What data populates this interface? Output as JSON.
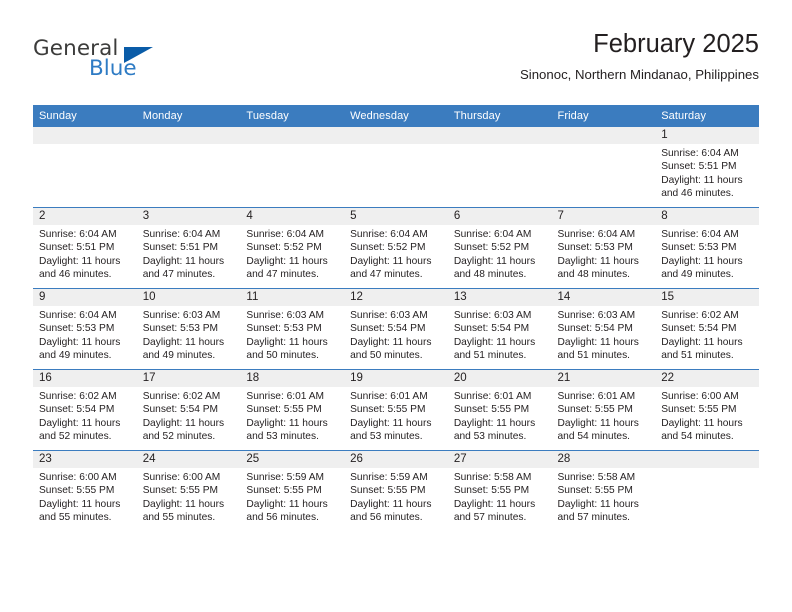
{
  "brand": {
    "name_part1": "General",
    "name_part2": "Blue",
    "flag_icon": "triangle-flag-icon"
  },
  "header": {
    "title": "February 2025",
    "subtitle": "Sinonoc, Northern Mindanao, Philippines"
  },
  "colors": {
    "header_blue": "#3b7cbf",
    "brand_blue": "#2e7bc4",
    "flag_blue": "#0a5ca8",
    "daynum_band": "#efefef",
    "text": "#231f20"
  },
  "weekdays": [
    "Sunday",
    "Monday",
    "Tuesday",
    "Wednesday",
    "Thursday",
    "Friday",
    "Saturday"
  ],
  "labels": {
    "sunrise": "Sunrise:",
    "sunset": "Sunset:",
    "daylight": "Daylight:"
  },
  "weeks": [
    [
      {
        "day": "",
        "empty": true
      },
      {
        "day": "",
        "empty": true
      },
      {
        "day": "",
        "empty": true
      },
      {
        "day": "",
        "empty": true
      },
      {
        "day": "",
        "empty": true
      },
      {
        "day": "",
        "empty": true
      },
      {
        "day": "1",
        "sunrise": "Sunrise: 6:04 AM",
        "sunset": "Sunset: 5:51 PM",
        "daylight_1": "Daylight: 11 hours",
        "daylight_2": "and 46 minutes."
      }
    ],
    [
      {
        "day": "2",
        "sunrise": "Sunrise: 6:04 AM",
        "sunset": "Sunset: 5:51 PM",
        "daylight_1": "Daylight: 11 hours",
        "daylight_2": "and 46 minutes."
      },
      {
        "day": "3",
        "sunrise": "Sunrise: 6:04 AM",
        "sunset": "Sunset: 5:51 PM",
        "daylight_1": "Daylight: 11 hours",
        "daylight_2": "and 47 minutes."
      },
      {
        "day": "4",
        "sunrise": "Sunrise: 6:04 AM",
        "sunset": "Sunset: 5:52 PM",
        "daylight_1": "Daylight: 11 hours",
        "daylight_2": "and 47 minutes."
      },
      {
        "day": "5",
        "sunrise": "Sunrise: 6:04 AM",
        "sunset": "Sunset: 5:52 PM",
        "daylight_1": "Daylight: 11 hours",
        "daylight_2": "and 47 minutes."
      },
      {
        "day": "6",
        "sunrise": "Sunrise: 6:04 AM",
        "sunset": "Sunset: 5:52 PM",
        "daylight_1": "Daylight: 11 hours",
        "daylight_2": "and 48 minutes."
      },
      {
        "day": "7",
        "sunrise": "Sunrise: 6:04 AM",
        "sunset": "Sunset: 5:53 PM",
        "daylight_1": "Daylight: 11 hours",
        "daylight_2": "and 48 minutes."
      },
      {
        "day": "8",
        "sunrise": "Sunrise: 6:04 AM",
        "sunset": "Sunset: 5:53 PM",
        "daylight_1": "Daylight: 11 hours",
        "daylight_2": "and 49 minutes."
      }
    ],
    [
      {
        "day": "9",
        "sunrise": "Sunrise: 6:04 AM",
        "sunset": "Sunset: 5:53 PM",
        "daylight_1": "Daylight: 11 hours",
        "daylight_2": "and 49 minutes."
      },
      {
        "day": "10",
        "sunrise": "Sunrise: 6:03 AM",
        "sunset": "Sunset: 5:53 PM",
        "daylight_1": "Daylight: 11 hours",
        "daylight_2": "and 49 minutes."
      },
      {
        "day": "11",
        "sunrise": "Sunrise: 6:03 AM",
        "sunset": "Sunset: 5:53 PM",
        "daylight_1": "Daylight: 11 hours",
        "daylight_2": "and 50 minutes."
      },
      {
        "day": "12",
        "sunrise": "Sunrise: 6:03 AM",
        "sunset": "Sunset: 5:54 PM",
        "daylight_1": "Daylight: 11 hours",
        "daylight_2": "and 50 minutes."
      },
      {
        "day": "13",
        "sunrise": "Sunrise: 6:03 AM",
        "sunset": "Sunset: 5:54 PM",
        "daylight_1": "Daylight: 11 hours",
        "daylight_2": "and 51 minutes."
      },
      {
        "day": "14",
        "sunrise": "Sunrise: 6:03 AM",
        "sunset": "Sunset: 5:54 PM",
        "daylight_1": "Daylight: 11 hours",
        "daylight_2": "and 51 minutes."
      },
      {
        "day": "15",
        "sunrise": "Sunrise: 6:02 AM",
        "sunset": "Sunset: 5:54 PM",
        "daylight_1": "Daylight: 11 hours",
        "daylight_2": "and 51 minutes."
      }
    ],
    [
      {
        "day": "16",
        "sunrise": "Sunrise: 6:02 AM",
        "sunset": "Sunset: 5:54 PM",
        "daylight_1": "Daylight: 11 hours",
        "daylight_2": "and 52 minutes."
      },
      {
        "day": "17",
        "sunrise": "Sunrise: 6:02 AM",
        "sunset": "Sunset: 5:54 PM",
        "daylight_1": "Daylight: 11 hours",
        "daylight_2": "and 52 minutes."
      },
      {
        "day": "18",
        "sunrise": "Sunrise: 6:01 AM",
        "sunset": "Sunset: 5:55 PM",
        "daylight_1": "Daylight: 11 hours",
        "daylight_2": "and 53 minutes."
      },
      {
        "day": "19",
        "sunrise": "Sunrise: 6:01 AM",
        "sunset": "Sunset: 5:55 PM",
        "daylight_1": "Daylight: 11 hours",
        "daylight_2": "and 53 minutes."
      },
      {
        "day": "20",
        "sunrise": "Sunrise: 6:01 AM",
        "sunset": "Sunset: 5:55 PM",
        "daylight_1": "Daylight: 11 hours",
        "daylight_2": "and 53 minutes."
      },
      {
        "day": "21",
        "sunrise": "Sunrise: 6:01 AM",
        "sunset": "Sunset: 5:55 PM",
        "daylight_1": "Daylight: 11 hours",
        "daylight_2": "and 54 minutes."
      },
      {
        "day": "22",
        "sunrise": "Sunrise: 6:00 AM",
        "sunset": "Sunset: 5:55 PM",
        "daylight_1": "Daylight: 11 hours",
        "daylight_2": "and 54 minutes."
      }
    ],
    [
      {
        "day": "23",
        "sunrise": "Sunrise: 6:00 AM",
        "sunset": "Sunset: 5:55 PM",
        "daylight_1": "Daylight: 11 hours",
        "daylight_2": "and 55 minutes."
      },
      {
        "day": "24",
        "sunrise": "Sunrise: 6:00 AM",
        "sunset": "Sunset: 5:55 PM",
        "daylight_1": "Daylight: 11 hours",
        "daylight_2": "and 55 minutes."
      },
      {
        "day": "25",
        "sunrise": "Sunrise: 5:59 AM",
        "sunset": "Sunset: 5:55 PM",
        "daylight_1": "Daylight: 11 hours",
        "daylight_2": "and 56 minutes."
      },
      {
        "day": "26",
        "sunrise": "Sunrise: 5:59 AM",
        "sunset": "Sunset: 5:55 PM",
        "daylight_1": "Daylight: 11 hours",
        "daylight_2": "and 56 minutes."
      },
      {
        "day": "27",
        "sunrise": "Sunrise: 5:58 AM",
        "sunset": "Sunset: 5:55 PM",
        "daylight_1": "Daylight: 11 hours",
        "daylight_2": "and 57 minutes."
      },
      {
        "day": "28",
        "sunrise": "Sunrise: 5:58 AM",
        "sunset": "Sunset: 5:55 PM",
        "daylight_1": "Daylight: 11 hours",
        "daylight_2": "and 57 minutes."
      },
      {
        "day": "",
        "empty": true
      }
    ]
  ]
}
